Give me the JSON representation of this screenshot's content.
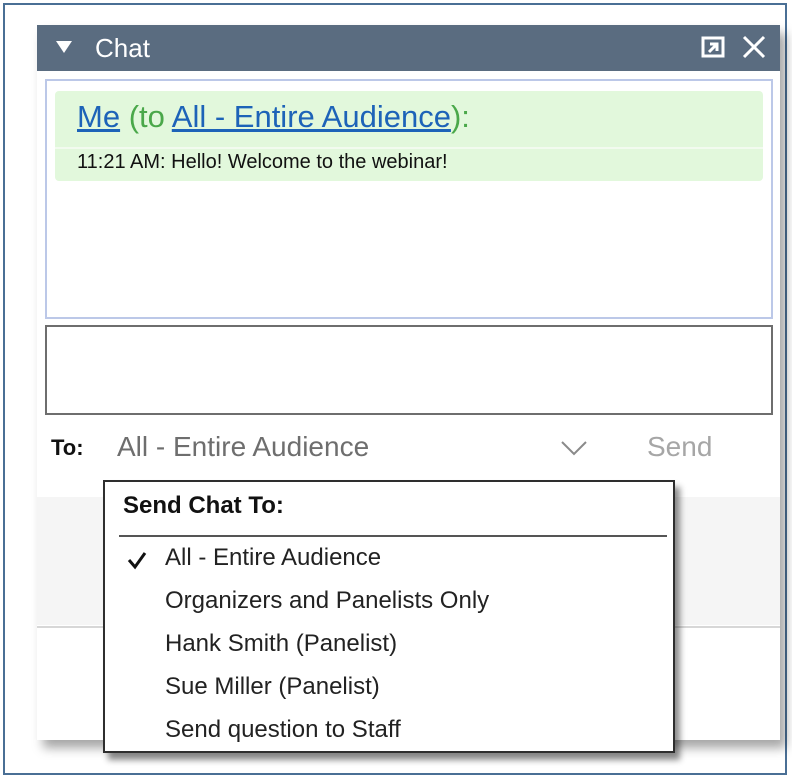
{
  "window": {
    "title": "Chat"
  },
  "message": {
    "sender": "Me",
    "to_prefix": " (to ",
    "recipient": "All - Entire Audience",
    "to_suffix": "):",
    "text": "11:21 AM: Hello! Welcome to the webinar!"
  },
  "composer": {
    "value": "",
    "to_label": "To:",
    "to_value": "All - Entire Audience",
    "send_label": "Send"
  },
  "dropdown": {
    "header": "Send Chat To:",
    "items": [
      {
        "label": "All - Entire Audience",
        "checked": true
      },
      {
        "label": "Organizers and Panelists Only",
        "checked": false
      },
      {
        "label": "Hank  Smith (Panelist)",
        "checked": false
      },
      {
        "label": "Sue Miller (Panelist)",
        "checked": false
      },
      {
        "label": "Send question to Staff",
        "checked": false
      }
    ]
  },
  "colors": {
    "titlebar": "#5a6c80",
    "message_bg": "#e2f8dc",
    "link": "#1d63b8",
    "green_text": "#4aa84a",
    "frame_border": "#4a6f95"
  },
  "icons": [
    "collapse-arrow-icon",
    "popout-icon",
    "close-icon",
    "chevron-down-icon",
    "checkmark-icon"
  ]
}
